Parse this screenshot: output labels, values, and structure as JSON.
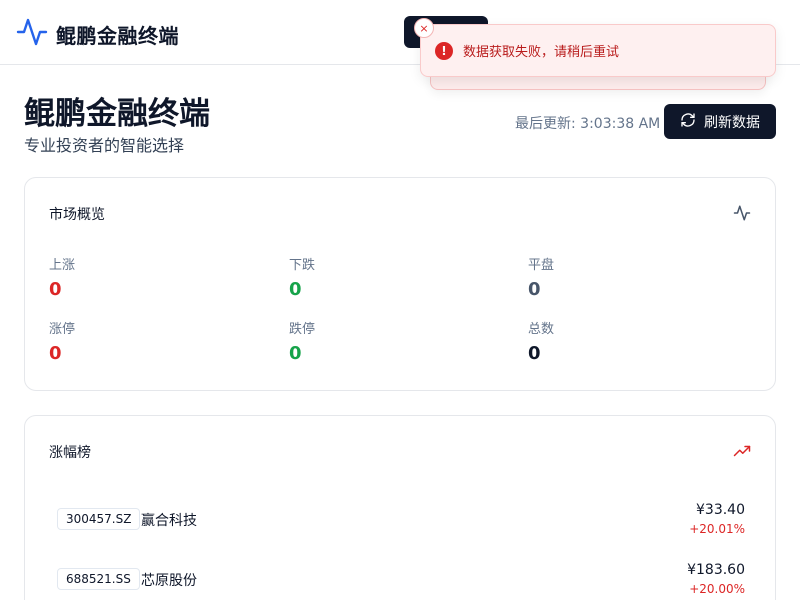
{
  "app": {
    "brand": "鲲鹏金融终端"
  },
  "toast": {
    "message": "数据获取失败，请稍后重试",
    "close_symbol": "×",
    "error_symbol": "!"
  },
  "header": {
    "title": "鲲鹏金融终端",
    "subtitle": "专业投资者的智能选择",
    "last_update": "最后更新: 3:03:38 AM",
    "refresh_label": "刷新数据"
  },
  "overview": {
    "title": "市场概览",
    "stats": [
      {
        "label": "上涨",
        "value": "0"
      },
      {
        "label": "下跌",
        "value": "0"
      },
      {
        "label": "平盘",
        "value": "0"
      },
      {
        "label": "涨停",
        "value": "0"
      },
      {
        "label": "跌停",
        "value": "0"
      },
      {
        "label": "总数",
        "value": "0"
      }
    ]
  },
  "gainers": {
    "title": "涨幅榜",
    "rows": [
      {
        "code": "300457.SZ",
        "name": "赢合科技",
        "price": "¥33.40",
        "change": "+20.01%"
      },
      {
        "code": "688521.SS",
        "name": "芯原股份",
        "price": "¥183.60",
        "change": "+20.00%"
      }
    ]
  },
  "colors": {
    "up": "#dc2626",
    "down": "#16a34a",
    "flat": "#475569",
    "primary": "#0f172a",
    "brand_icon": "#2563eb"
  },
  "icons": {
    "brand": "activity-pulse-icon",
    "refresh": "refresh-icon",
    "overview": "activity-icon",
    "gainers": "trending-up-icon",
    "toast": "error-circle-icon",
    "close": "close-icon"
  }
}
